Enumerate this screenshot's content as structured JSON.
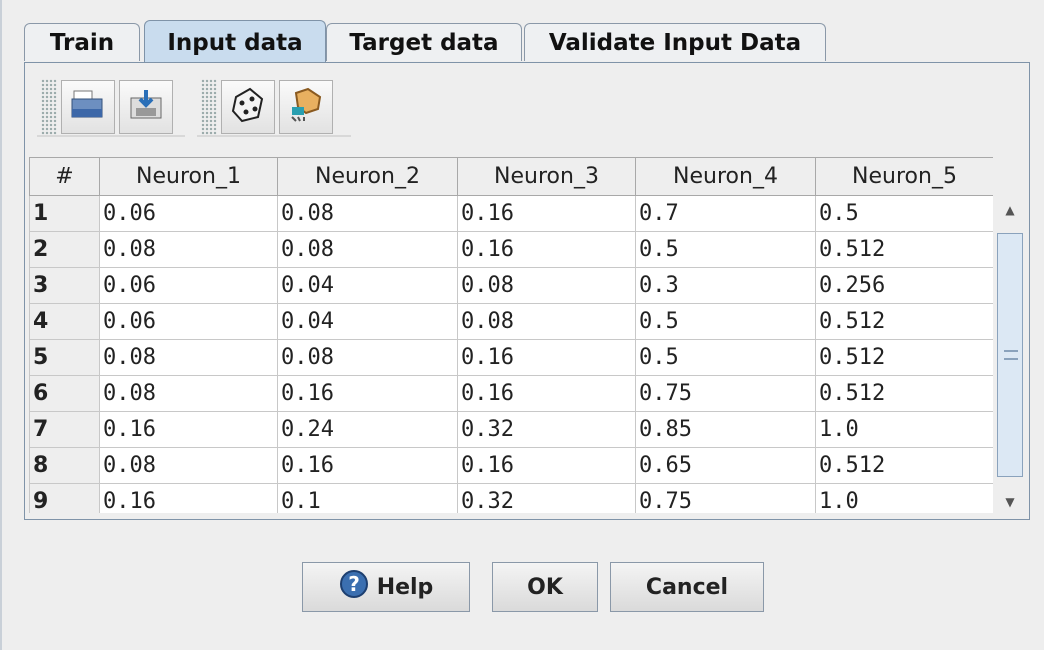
{
  "tabs": [
    {
      "label": "Train",
      "active": false
    },
    {
      "label": "Input data",
      "active": true
    },
    {
      "label": "Target data",
      "active": false
    },
    {
      "label": "Validate Input Data",
      "active": false
    }
  ],
  "toolbar": {
    "icons": [
      "open-folder-icon",
      "import-icon",
      "randomize-dice-icon",
      "clear-hand-icon"
    ]
  },
  "table": {
    "columns": [
      "#",
      "Neuron_1",
      "Neuron_2",
      "Neuron_3",
      "Neuron_4",
      "Neuron_5"
    ],
    "rows": [
      [
        "1",
        "0.06",
        "0.08",
        "0.16",
        "0.7",
        "0.5"
      ],
      [
        "2",
        "0.08",
        "0.08",
        "0.16",
        "0.5",
        "0.512"
      ],
      [
        "3",
        "0.06",
        "0.04",
        "0.08",
        "0.3",
        "0.256"
      ],
      [
        "4",
        "0.06",
        "0.04",
        "0.08",
        "0.5",
        "0.512"
      ],
      [
        "5",
        "0.08",
        "0.08",
        "0.16",
        "0.5",
        "0.512"
      ],
      [
        "6",
        "0.08",
        "0.16",
        "0.16",
        "0.75",
        "0.512"
      ],
      [
        "7",
        "0.16",
        "0.24",
        "0.32",
        "0.85",
        "1.0"
      ],
      [
        "8",
        "0.08",
        "0.16",
        "0.16",
        "0.65",
        "0.512"
      ],
      [
        "9",
        "0.16",
        "0.1",
        "0.32",
        "0.75",
        "1.0"
      ]
    ]
  },
  "buttons": {
    "help": "Help",
    "ok": "OK",
    "cancel": "Cancel"
  },
  "colors": {
    "active_tab": "#c9dcee",
    "border": "#7f93a8"
  }
}
